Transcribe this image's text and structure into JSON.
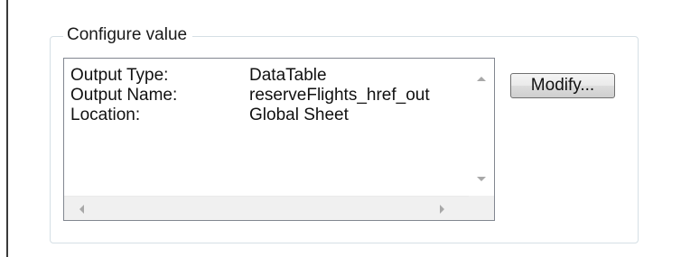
{
  "groupbox": {
    "title": "Configure value"
  },
  "output_list": {
    "rows": [
      {
        "label": "Output Type:",
        "value": "DataTable"
      },
      {
        "label": "Output Name:",
        "value": "reserveFlights_href_out"
      },
      {
        "label": "Location:",
        "value": "Global Sheet"
      }
    ]
  },
  "buttons": {
    "modify_label": "Modify..."
  },
  "icons": {
    "scroll_up": "chevron-up-icon",
    "scroll_down": "chevron-down-icon",
    "scroll_left": "chevron-left-icon",
    "scroll_right": "chevron-right-icon"
  }
}
